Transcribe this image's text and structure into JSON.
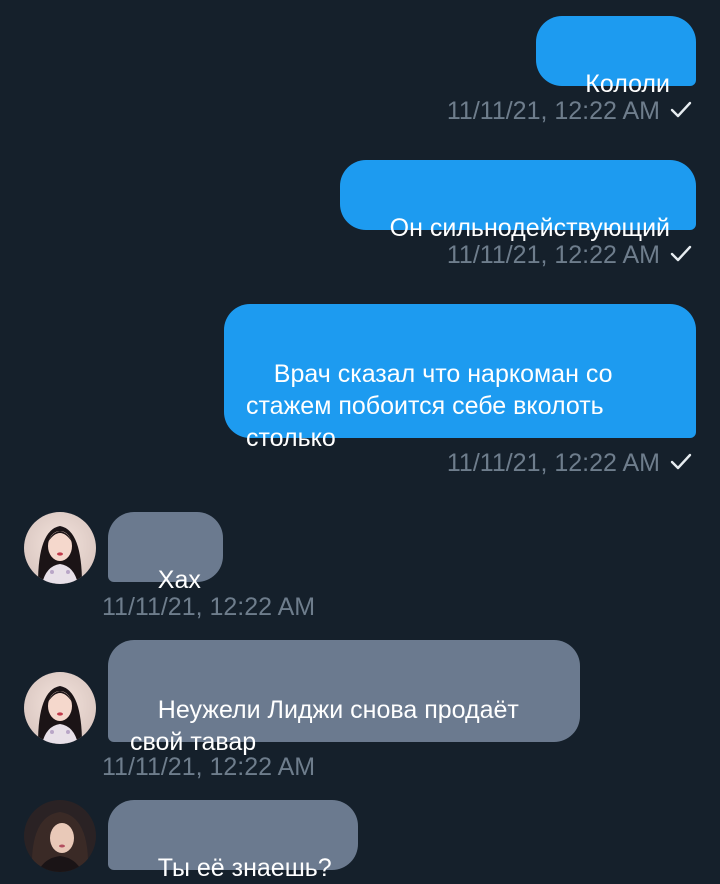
{
  "colors": {
    "background": "#15202b",
    "outgoing_bubble": "#1d9bf0",
    "incoming_bubble": "#6b7a8f",
    "timestamp": "#6e7d8c"
  },
  "messages": [
    {
      "direction": "outgoing",
      "text": "Кололи",
      "timestamp": "11/11/21, 12:22 AM",
      "read_icon": "checkmark-icon"
    },
    {
      "direction": "outgoing",
      "text": "Он сильнодействующий",
      "timestamp": "11/11/21, 12:22 AM",
      "read_icon": "checkmark-icon"
    },
    {
      "direction": "outgoing",
      "text": "Врач сказал что наркоман со\nстажем побоится себе вколоть\nстолько",
      "timestamp": "11/11/21, 12:22 AM",
      "read_icon": "checkmark-icon"
    },
    {
      "direction": "incoming",
      "text": "Хах",
      "timestamp": "11/11/21, 12:22 AM",
      "avatar": "user-avatar"
    },
    {
      "direction": "incoming",
      "text": "Неужели Лиджи снова продаёт\nсвой тавар",
      "timestamp": "11/11/21, 12:22 AM",
      "avatar": "user-avatar"
    },
    {
      "direction": "incoming",
      "text": "Ты её знаешь?",
      "avatar": "user-avatar-2"
    }
  ]
}
